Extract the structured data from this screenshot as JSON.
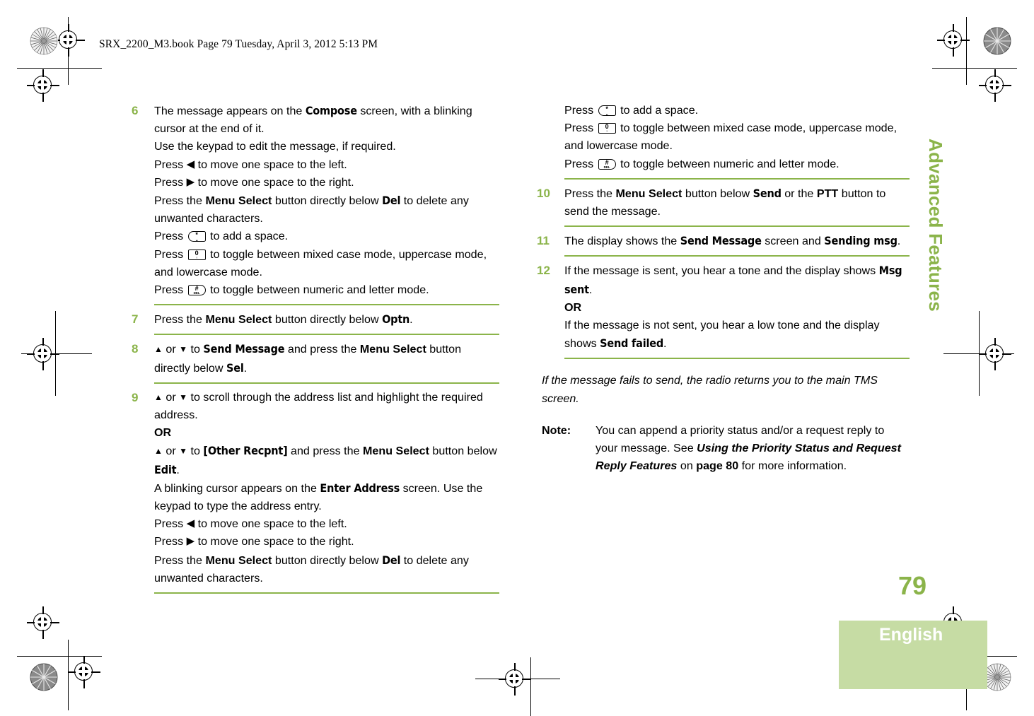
{
  "document": {
    "header_line": "SRX_2200_M3.book  Page 79  Tuesday, April 3, 2012  5:13 PM",
    "chapter_tab": "Advanced Features",
    "page_number": "79",
    "language": "English",
    "colors": {
      "accent_green": "#8BB44A",
      "footer_band": "#C6DCA4",
      "text": "#000000"
    }
  },
  "keys": {
    "star": {
      "top": "*",
      "bottom": "␣",
      "name": "star-key"
    },
    "zero": {
      "top": "0",
      "bottom": "♀",
      "name": "zero-key"
    },
    "hash": {
      "top": "#",
      "bottom": "DEL",
      "name": "hash-del-key"
    }
  },
  "glyphs": {
    "left_arrow": "◀",
    "right_arrow": "▶",
    "up_arrow": "▲",
    "down_arrow": "▼"
  },
  "left_column": {
    "steps": [
      {
        "number": "6",
        "lines": [
          "The message appears on the <b class=\"disp\">Compose</b> screen, with a blinking cursor at the end of it.",
          "Use the keypad to edit the message, if required.",
          "Press <span class=\"tri tri-l\">◀</span> to move one space to the left.",
          "Press <span class=\"tri tri-r\">▶</span> to move one space to the right.",
          "Press the <b>Menu Select</b> button directly below <b class=\"disp\">Del</b> to delete any unwanted characters.",
          "Press KEY_STAR to add a space.",
          "Press KEY_ZERO to toggle between mixed case mode, uppercase mode, and lowercase mode.",
          "Press KEY_HASH to toggle between numeric and letter mode."
        ]
      },
      {
        "number": "7",
        "lines": [
          "Press the <b>Menu Select</b> button directly below <b class=\"disp\">Optn</b>."
        ]
      },
      {
        "number": "8",
        "lines": [
          "<span class=\"tri tri-u\">▲</span> or <span class=\"tri tri-d\">▼</span> to <b class=\"disp\">Send Message</b> and press the <b>Menu Select</b> button directly below <b class=\"disp\">Sel</b>."
        ]
      },
      {
        "number": "9",
        "lines": [
          "<span class=\"tri tri-u\">▲</span> or <span class=\"tri tri-d\">▼</span> to scroll through the address list and highlight the required address.",
          "<b>OR</b>",
          "<span class=\"tri tri-u\">▲</span> or <span class=\"tri tri-d\">▼</span> to <b class=\"disp\">[Other Recpnt]</b> and press the <b>Menu Select</b> button below <b class=\"disp\">Edit</b>.",
          "A blinking cursor appears on the <b class=\"disp\">Enter Address</b> screen. Use the keypad to type the address entry.",
          "Press <span class=\"tri tri-l\">◀</span> to move one space to the left.",
          "Press <span class=\"tri tri-r\">▶</span> to move one space to the right.",
          "Press the <b>Menu Select</b> button directly below <b class=\"disp\">Del</b> to delete any unwanted characters."
        ]
      }
    ]
  },
  "right_column": {
    "continuation": [
      "Press KEY_STAR to add a space.",
      "Press KEY_ZERO to toggle between mixed case mode, uppercase mode, and lowercase mode.",
      "Press KEY_HASH to toggle between numeric and letter mode."
    ],
    "steps": [
      {
        "number": "10",
        "lines": [
          "Press the <b>Menu Select</b> button below <b class=\"disp\">Send</b> or the <b>PTT</b> button to send the message."
        ]
      },
      {
        "number": "11",
        "lines": [
          "The display shows the <b class=\"disp\">Send Message</b> screen and <b class=\"disp\">Sending msg</b>."
        ]
      },
      {
        "number": "12",
        "lines": [
          "If the message is sent, you hear a tone and the display shows <b class=\"disp\">Msg sent</b>.",
          "<b>OR</b>",
          "If the message is not sent, you hear a low tone and the display shows <b class=\"disp\">Send failed</b>."
        ]
      }
    ],
    "italic_note": "If the message fails to send, the radio returns you to the main TMS screen.",
    "note": {
      "label": "Note:",
      "body": "You can append a priority status and/or a request reply to your message. See <em>Using the Priority Status and Request Reply Features</em> on <b>page 80</b> for more information."
    }
  }
}
